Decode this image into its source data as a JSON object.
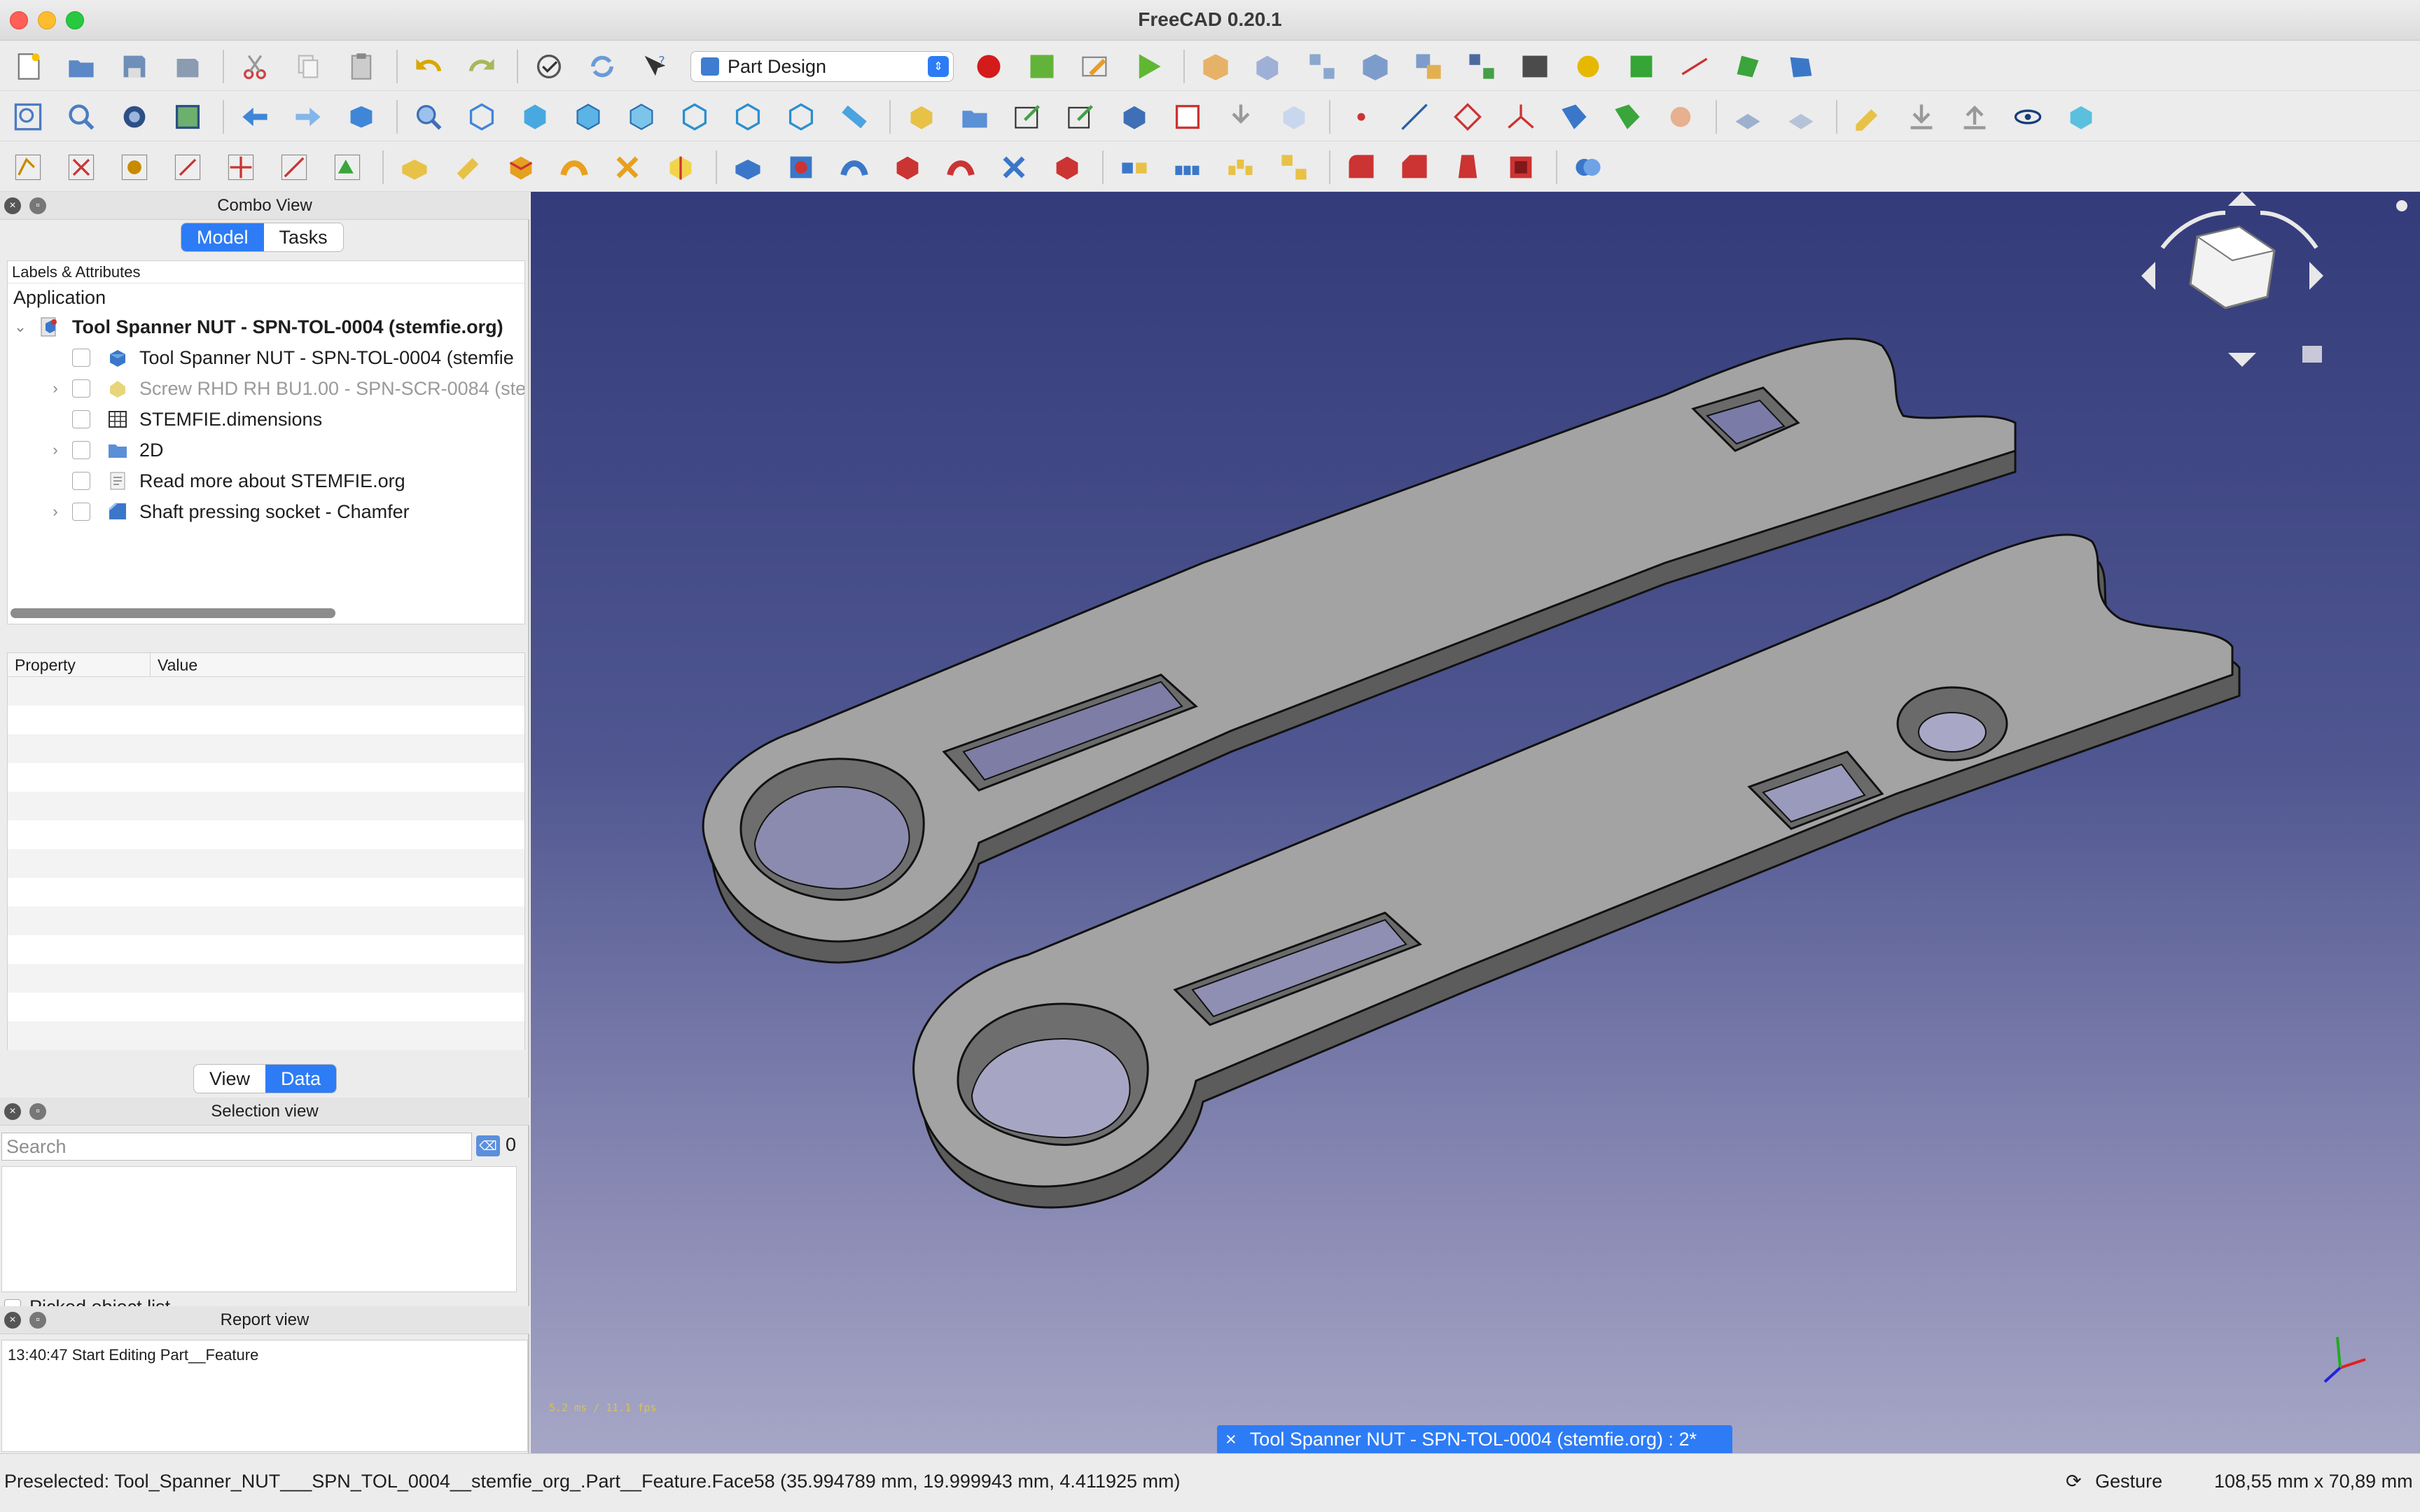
{
  "window": {
    "title": "FreeCAD 0.20.1"
  },
  "toolbar": {
    "workbench_selected": "Part Design",
    "row1_icons": [
      "new-icon",
      "open-icon",
      "save-icon",
      "save-as-icon",
      "cut-icon",
      "copy-icon",
      "paste-icon",
      "undo-icon",
      "redo-icon",
      "refresh-check-icon",
      "refresh-icon",
      "whats-this-icon"
    ],
    "macro_icons": [
      "record-macro-icon",
      "stop-macro-icon",
      "edit-macro-icon",
      "run-macro-icon"
    ],
    "accent": "#2d7cf6"
  },
  "combo_view": {
    "title": "Combo View",
    "tabs": [
      "Model",
      "Tasks"
    ],
    "active_tab": "Model",
    "tree_header": "Labels & Attributes",
    "application_label": "Application",
    "document": "Tool Spanner NUT - SPN-TOL-0004 (stemfie.org)",
    "items": [
      {
        "label": "Tool Spanner NUT - SPN-TOL-0004 (stemfie",
        "icon": "part-body-icon",
        "expandable": false,
        "dim": false
      },
      {
        "label": "Screw RHD RH BU1.00 - SPN-SCR-0084 (ste",
        "icon": "part-feature-icon",
        "expandable": true,
        "dim": true
      },
      {
        "label": "STEMFIE.dimensions",
        "icon": "spreadsheet-icon",
        "expandable": false,
        "dim": false
      },
      {
        "label": "2D",
        "icon": "folder-icon",
        "expandable": true,
        "dim": false
      },
      {
        "label": "Read more about STEMFIE.org",
        "icon": "text-document-icon",
        "expandable": false,
        "dim": false
      },
      {
        "label": "Shaft pressing socket - Chamfer",
        "icon": "chamfer-icon",
        "expandable": true,
        "dim": false
      }
    ],
    "property_columns": [
      "Property",
      "Value"
    ],
    "view_tabs": [
      "View",
      "Data"
    ],
    "active_view_tab": "Data"
  },
  "selection_view": {
    "title": "Selection view",
    "search_placeholder": "Search",
    "count": "0",
    "picked_label": "Picked object list"
  },
  "report_view": {
    "title": "Report view",
    "log": "13:40:47  Start Editing Part__Feature"
  },
  "viewport": {
    "fps": "5.2 ms / 11.1 fps",
    "document_tab": "Tool Spanner NUT - SPN-TOL-0004 (stemfie.org) : 2*"
  },
  "status": {
    "preselected": "Preselected: Tool_Spanner_NUT___SPN_TOL_0004__stemfie_org_.Part__Feature.Face58 (35.994789 mm, 19.999943 mm, 4.411925 mm)",
    "navigation": "Gesture",
    "dimensions": "108,55 mm x 70,89 mm"
  }
}
